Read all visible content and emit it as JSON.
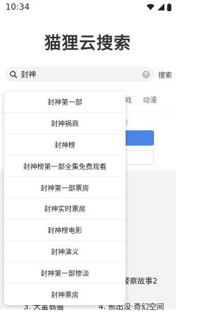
{
  "status_bar": {
    "time": "10:34"
  },
  "app_title": "猫狸云搜索",
  "search": {
    "query": "封神",
    "button_label": "搜索"
  },
  "tabs": [
    {
      "label": "游戏"
    },
    {
      "label": "动漫"
    }
  ],
  "background": {
    "hint_text": "行",
    "secondary_button_fragment": "·"
  },
  "rankings": [
    {
      "label": "警察故事2"
    },
    {
      "label": "3. 大富翁猫"
    },
    {
      "label": "4. 熊出没·奇幻空间"
    }
  ],
  "suggestions": [
    "封神第一部",
    "封神祸商",
    "封神榜",
    "封神榜第一部全集免费观看",
    "封神第一部票房",
    "封神实时票房",
    "封神榜电影",
    "封神演义",
    "封神第一部惨淡",
    "封神票房"
  ],
  "colors": {
    "accent": "#4a86e8"
  }
}
